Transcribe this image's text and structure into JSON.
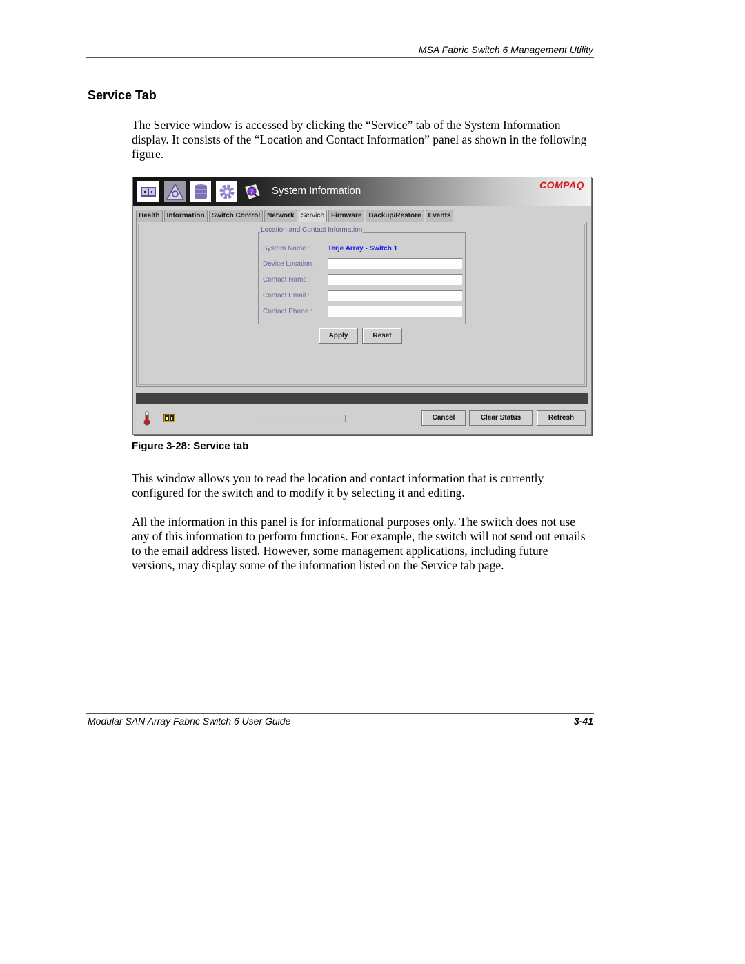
{
  "page": {
    "running_header": "MSA Fabric Switch 6 Management Utility",
    "section_title": "Service Tab",
    "intro_paragraph": "The Service window is accessed by clicking the “Service” tab of the System Information display. It consists of the “Location and Contact Information” panel as shown in the following figure.",
    "figure_caption": "Figure 3-28:  Service tab",
    "paragraph_2": "This window allows you to read the location and contact information that is currently configured for the switch and to modify it by selecting it and editing.",
    "paragraph_3": "All the information in this panel is for informational purposes only. The switch does not use any of this information to perform functions. For example, the switch will not send out emails to the email address listed. However, some management applications, including future versions, may display some of the information listed on the Service tab page.",
    "footer_title": "Modular SAN Array Fabric Switch 6 User Guide",
    "page_number": "3-41"
  },
  "app": {
    "window_title": "System Information",
    "brand": "COMPAQ",
    "toolbar_icons": [
      "switch-view-icon",
      "fabric-topology-icon",
      "database-icon",
      "settings-gear-icon",
      "help-magnifier-icon"
    ],
    "tabs": [
      {
        "label": "Health",
        "active": false
      },
      {
        "label": "Information",
        "active": false
      },
      {
        "label": "Switch Control",
        "active": false
      },
      {
        "label": "Network",
        "active": false
      },
      {
        "label": "Service",
        "active": true
      },
      {
        "label": "Firmware",
        "active": false
      },
      {
        "label": "Backup/Restore",
        "active": false
      },
      {
        "label": "Events",
        "active": false
      }
    ],
    "panel": {
      "title": "Location and Contact Information",
      "system_name_label": "System Name :",
      "system_name_value": "Terje Array - Switch 1",
      "fields": [
        {
          "label": "Device Location :",
          "value": ""
        },
        {
          "label": "Contact Name :",
          "value": ""
        },
        {
          "label": "Contact Email :",
          "value": ""
        },
        {
          "label": "Contact Phone :",
          "value": ""
        }
      ],
      "apply_label": "Apply",
      "reset_label": "Reset"
    },
    "status_text": "",
    "progress_percent": 0,
    "bottom_buttons": {
      "cancel_label": "Cancel",
      "clear_status_label": "Clear Status",
      "refresh_label": "Refresh"
    },
    "colors": {
      "label": "#6a6aa0",
      "system_name_value": "#1a1aee",
      "brand": "#d41a1a",
      "status_bar": "#424242"
    }
  }
}
